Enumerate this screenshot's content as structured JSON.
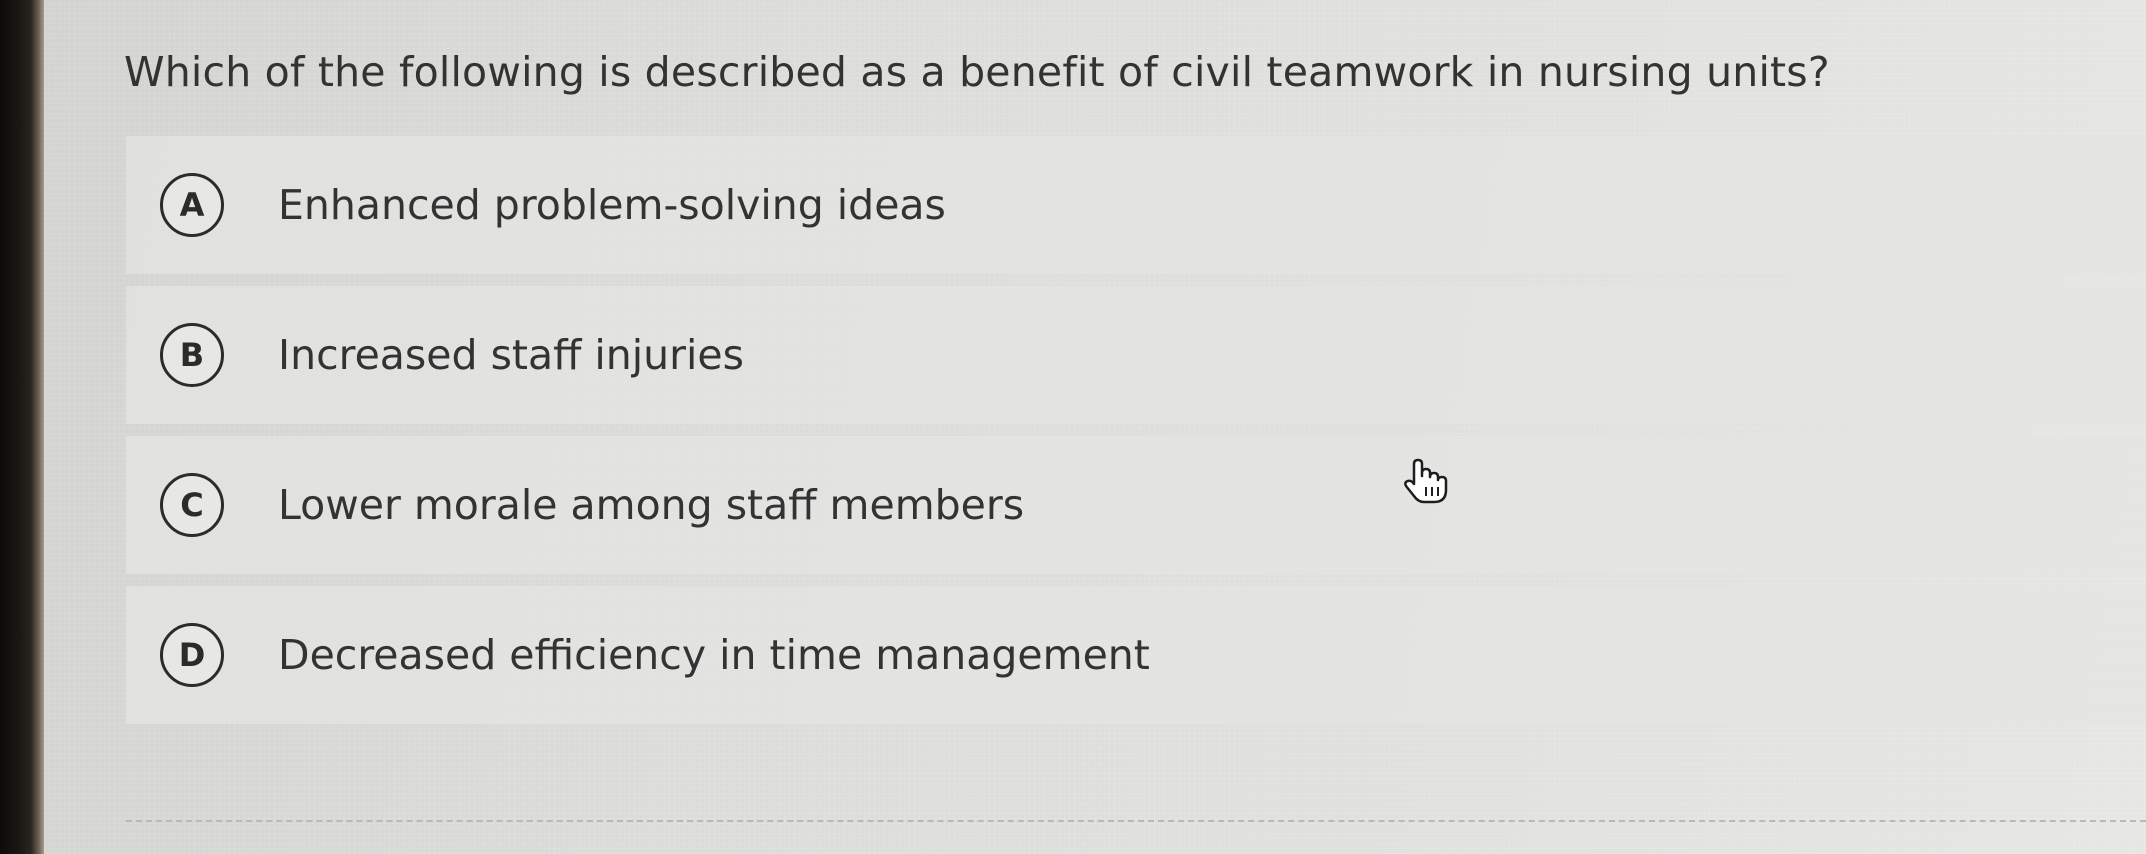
{
  "question": {
    "text": "Which of the following is described as a benefit of civil teamwork in nursing units?"
  },
  "options": [
    {
      "letter": "A",
      "label": "Enhanced problem-solving ideas"
    },
    {
      "letter": "B",
      "label": "Increased staff injuries"
    },
    {
      "letter": "C",
      "label": "Lower morale among staff members"
    },
    {
      "letter": "D",
      "label": "Decreased efficiency in time management"
    }
  ],
  "cursor": {
    "icon": "pointer-hand-icon"
  },
  "colors": {
    "background": "#dcdcd9",
    "text": "#333333",
    "option_circle": "#2b2b2b"
  }
}
